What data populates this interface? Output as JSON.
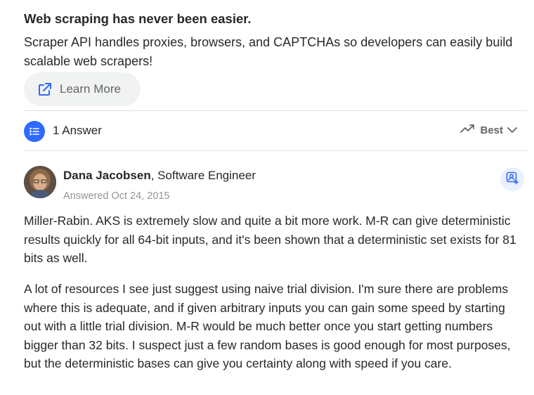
{
  "ad": {
    "title": "Web scraping has never been easier.",
    "description": "Scraper API handles proxies, browsers, and CAPTCHAs so developers can easily build scalable web scrapers!",
    "learn_more_label": "Learn More"
  },
  "answers_bar": {
    "count_label": "1 Answer",
    "sort_label": "Best"
  },
  "answer": {
    "author_name": "Dana Jacobsen",
    "author_credential": ", Software Engineer",
    "answered_date": "Answered Oct 24, 2015",
    "paragraphs": [
      "Miller-Rabin. AKS is extremely slow and quite a bit more work. M-R can give deterministic results quickly for all 64-bit inputs, and it's been shown that a deterministic set exists for 81 bits as well.",
      "A lot of resources I see just suggest using naive trial division. I'm sure there are problems where this is adequate, and if given arbitrary inputs you can gain some speed by starting out with a little trial division. M-R would be much better once you start getting numbers bigger than 32 bits. I suspect just a few random bases is good enough for most purposes, but the deterministic bases can give you certainty along with speed if you care."
    ]
  },
  "colors": {
    "accent": "#2e69ff",
    "text": "#282829",
    "muted": "#939598",
    "divider": "#dee0e1"
  }
}
